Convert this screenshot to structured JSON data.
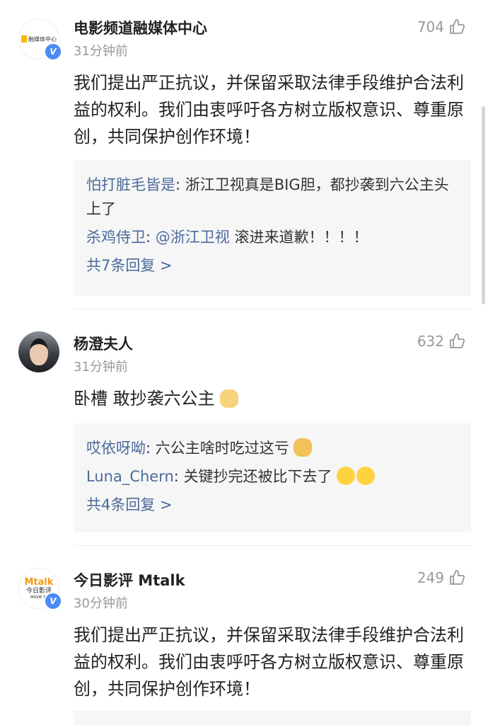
{
  "comments": [
    {
      "username": "电影频道融媒体中心",
      "time": "31分钟前",
      "likes": "704",
      "avatar_text": "融媒体中心",
      "text": "我们提出严正抗议，并保留采取法律手段维护合法利益的权利。我们由衷呼吁各方树立版权意识、尊重原创，共同保护创作环境！",
      "replies": [
        {
          "name": "怕打脏毛皆是",
          "sep": ": ",
          "text": "浙江卫视真是BIG胆，都抄袭到六公主头上了"
        },
        {
          "name": "杀鸡侍卫",
          "sep": ": ",
          "mention": "@浙江卫视",
          "text": " 滚进来道歉！！！！"
        }
      ],
      "more": "共7条回复 >"
    },
    {
      "username": "杨澄夫人",
      "time": "31分钟前",
      "likes": "632",
      "text": "卧槽 敢抄袭六公主",
      "replies": [
        {
          "name": "哎依呀呦",
          "sep": ": ",
          "text": "六公主啥时吃过这亏"
        },
        {
          "name": "Luna_Chern",
          "sep": ": ",
          "text": "关键抄完还被比下去了"
        }
      ],
      "more": "共4条回复 >"
    },
    {
      "username": "今日影评 Mtalk",
      "time": "30分钟前",
      "likes": "249",
      "avatar_text": "今日影评",
      "avatar_sub": "MOVIE TA",
      "text": "我们提出严正抗议，并保留采取法律手段维护合法利益的权利。我们由衷呼吁各方树立版权意识、尊重原创，共同保护创作环境！"
    }
  ]
}
